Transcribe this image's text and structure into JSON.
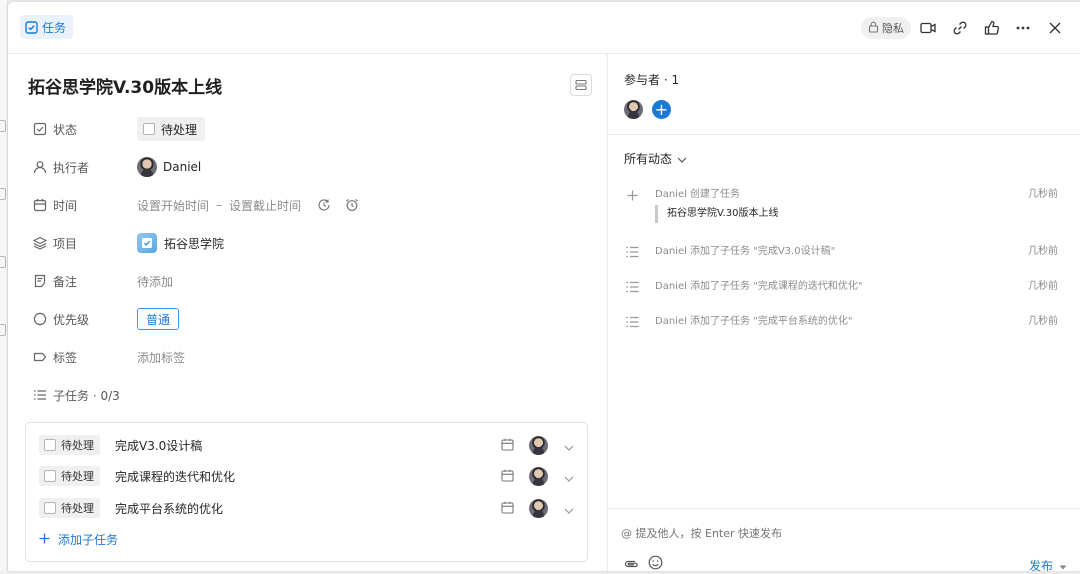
{
  "header": {
    "type_label": "任务",
    "privacy_label": "隐私"
  },
  "task": {
    "title": "拓谷思学院V.30版本上线"
  },
  "fields": {
    "status": {
      "label": "状态",
      "value": "待处理"
    },
    "assignee": {
      "label": "执行者",
      "value": "Daniel"
    },
    "time": {
      "label": "时间",
      "start_placeholder": "设置开始时间",
      "separator": "–",
      "end_placeholder": "设置截止时间"
    },
    "project": {
      "label": "项目",
      "value": "拓谷思学院"
    },
    "note": {
      "label": "备注",
      "value": "待添加"
    },
    "priority": {
      "label": "优先级",
      "value": "普通"
    },
    "tags": {
      "label": "标签",
      "value": "添加标签"
    },
    "subtasks": {
      "label": "子任务 · 0/3"
    }
  },
  "subtasks": {
    "items": [
      {
        "status": "待处理",
        "title": "完成V3.0设计稿"
      },
      {
        "status": "待处理",
        "title": "完成课程的迭代和优化"
      },
      {
        "status": "待处理",
        "title": "完成平台系统的优化"
      }
    ],
    "add_label": "添加子任务"
  },
  "sidebar": {
    "participants_label": "参与者 · 1",
    "filter_label": "所有动态",
    "activities": [
      {
        "icon": "plus-icon",
        "text": "Daniel 创建了任务",
        "time": "几秒前",
        "quote": "拓谷思学院V.30版本上线"
      },
      {
        "icon": "list-icon",
        "text": "Daniel 添加了子任务 \"完成V3.0设计稿\"",
        "time": "几秒前"
      },
      {
        "icon": "list-icon",
        "text": "Daniel 添加了子任务 \"完成课程的迭代和优化\"",
        "time": "几秒前"
      },
      {
        "icon": "list-icon",
        "text": "Daniel 添加了子任务 \"完成平台系统的优化\"",
        "time": "几秒前"
      }
    ],
    "comment_placeholder": "@ 提及他人，按 Enter 快速发布",
    "publish_label": "发布"
  },
  "colors": {
    "accent": "#1b79d6",
    "accent_bg": "#e8f1fc"
  }
}
